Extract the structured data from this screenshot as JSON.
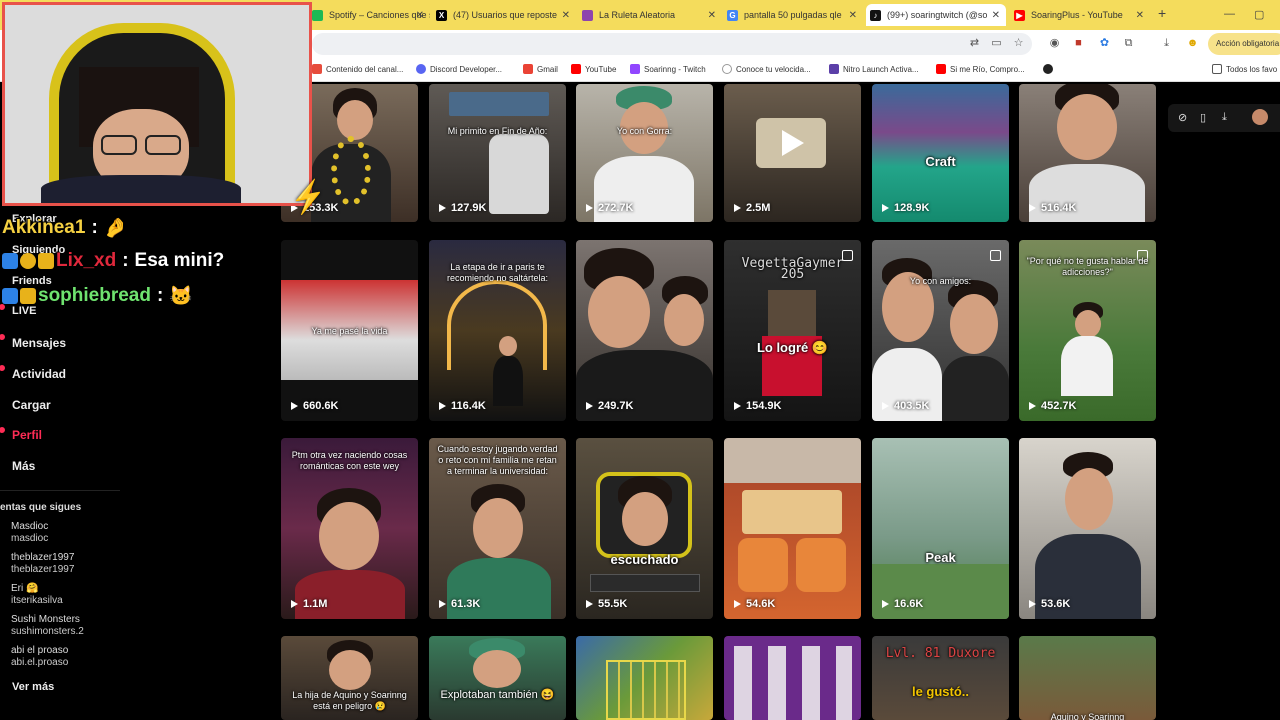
{
  "browser": {
    "tabs": [
      {
        "label": "Spotify – Canciones que s"
      },
      {
        "label": "(47) Usuarios que reposte"
      },
      {
        "label": "La Ruleta Aleatoria"
      },
      {
        "label": "pantalla 50 pulgadas qle"
      },
      {
        "label": "(99+) soaringtwitch (@so"
      },
      {
        "label": "SoaringPlus - YouTube"
      }
    ],
    "accion_label": "Acción obligatoria",
    "bookmarks": [
      {
        "label": "Contenido del canal..."
      },
      {
        "label": "Discord Developer..."
      },
      {
        "label": "Gmail"
      },
      {
        "label": "YouTube"
      },
      {
        "label": "Soarinng - Twitch"
      },
      {
        "label": "Conoce tu velocida..."
      },
      {
        "label": "Nitro Launch Activa..."
      },
      {
        "label": "Si me Río, Compro..."
      }
    ],
    "all_bookmarks_label": "Todos los favo"
  },
  "nav": {
    "items": [
      {
        "label": "Explorar"
      },
      {
        "label": "Siguiendo"
      },
      {
        "label": "Friends"
      },
      {
        "label": "LIVE"
      },
      {
        "label": "Mensajes"
      },
      {
        "label": "Actividad"
      },
      {
        "label": "Cargar"
      },
      {
        "label": "Perfil"
      },
      {
        "label": "Más"
      }
    ],
    "following_title": "entas que sigues",
    "following": [
      {
        "name": "Masdioc",
        "user": "masdioc"
      },
      {
        "name": "theblazer1997",
        "user": "theblazer1997"
      },
      {
        "name": "Eri 🤗",
        "user": "itserikasilva"
      },
      {
        "name": "Sushi Monsters",
        "user": "sushimonsters.2"
      },
      {
        "name": "abi el proaso",
        "user": "abi.el.proaso"
      }
    ],
    "see_more": "Ver más"
  },
  "chat": [
    {
      "user": "Akkinea1",
      "sep": ":",
      "msg": "🤌",
      "color": "#f5d142"
    },
    {
      "user": "Lix_xd",
      "sep": ":",
      "msg": "Esa mini?",
      "color": "#e0283c"
    },
    {
      "user": "sophiebread",
      "sep": ":",
      "msg": "🐱",
      "color": "#6fe36f"
    }
  ],
  "videos": [
    {
      "views": "153.3K",
      "caption": ""
    },
    {
      "views": "127.9K",
      "caption": "Mi primito en Fin de Año:"
    },
    {
      "views": "272.7K",
      "caption": "Yo con Gorra:"
    },
    {
      "views": "2.5M",
      "caption": ""
    },
    {
      "views": "128.9K",
      "caption": "Craft"
    },
    {
      "views": "516.4K",
      "caption": ""
    },
    {
      "views": "660.6K",
      "caption": "Ya me pasé la vida"
    },
    {
      "views": "116.4K",
      "caption": "La etapa de ir a paris te recomiendo no saltártela:"
    },
    {
      "views": "249.7K",
      "caption": ""
    },
    {
      "views": "154.9K",
      "caption": "Lo logré 😊",
      "top": "VegettaGaymer 205"
    },
    {
      "views": "403.5K",
      "caption": "Yo con amigos:"
    },
    {
      "views": "452.7K",
      "caption": "\"Por qué no te gusta hablar de adicciones?\""
    },
    {
      "views": "1.1M",
      "caption": "Ptm otra vez naciendo cosas románticas con este wey"
    },
    {
      "views": "61.3K",
      "caption": "Cuando estoy jugando verdad o reto con mi familia me retan a terminar la universidad:"
    },
    {
      "views": "55.5K",
      "caption": "escuchado"
    },
    {
      "views": "54.6K",
      "caption": ""
    },
    {
      "views": "16.6K",
      "caption": "Peak"
    },
    {
      "views": "53.6K",
      "caption": ""
    },
    {
      "views": "",
      "caption": "La hija de Aquino y Soarinng está en peligro 😢"
    },
    {
      "views": "",
      "caption": "Explotaban también 😆"
    },
    {
      "views": "",
      "caption": ""
    },
    {
      "views": "",
      "caption": ""
    },
    {
      "views": "",
      "caption": "le gustó..",
      "top": "Lvl. 81 Duxore"
    },
    {
      "views": "",
      "caption": "Aquino y Soarinng"
    }
  ],
  "colors": {
    "accent": "#fe2c55",
    "tabbar": "#f4dc5c",
    "webcam_border": "#e8524a"
  }
}
